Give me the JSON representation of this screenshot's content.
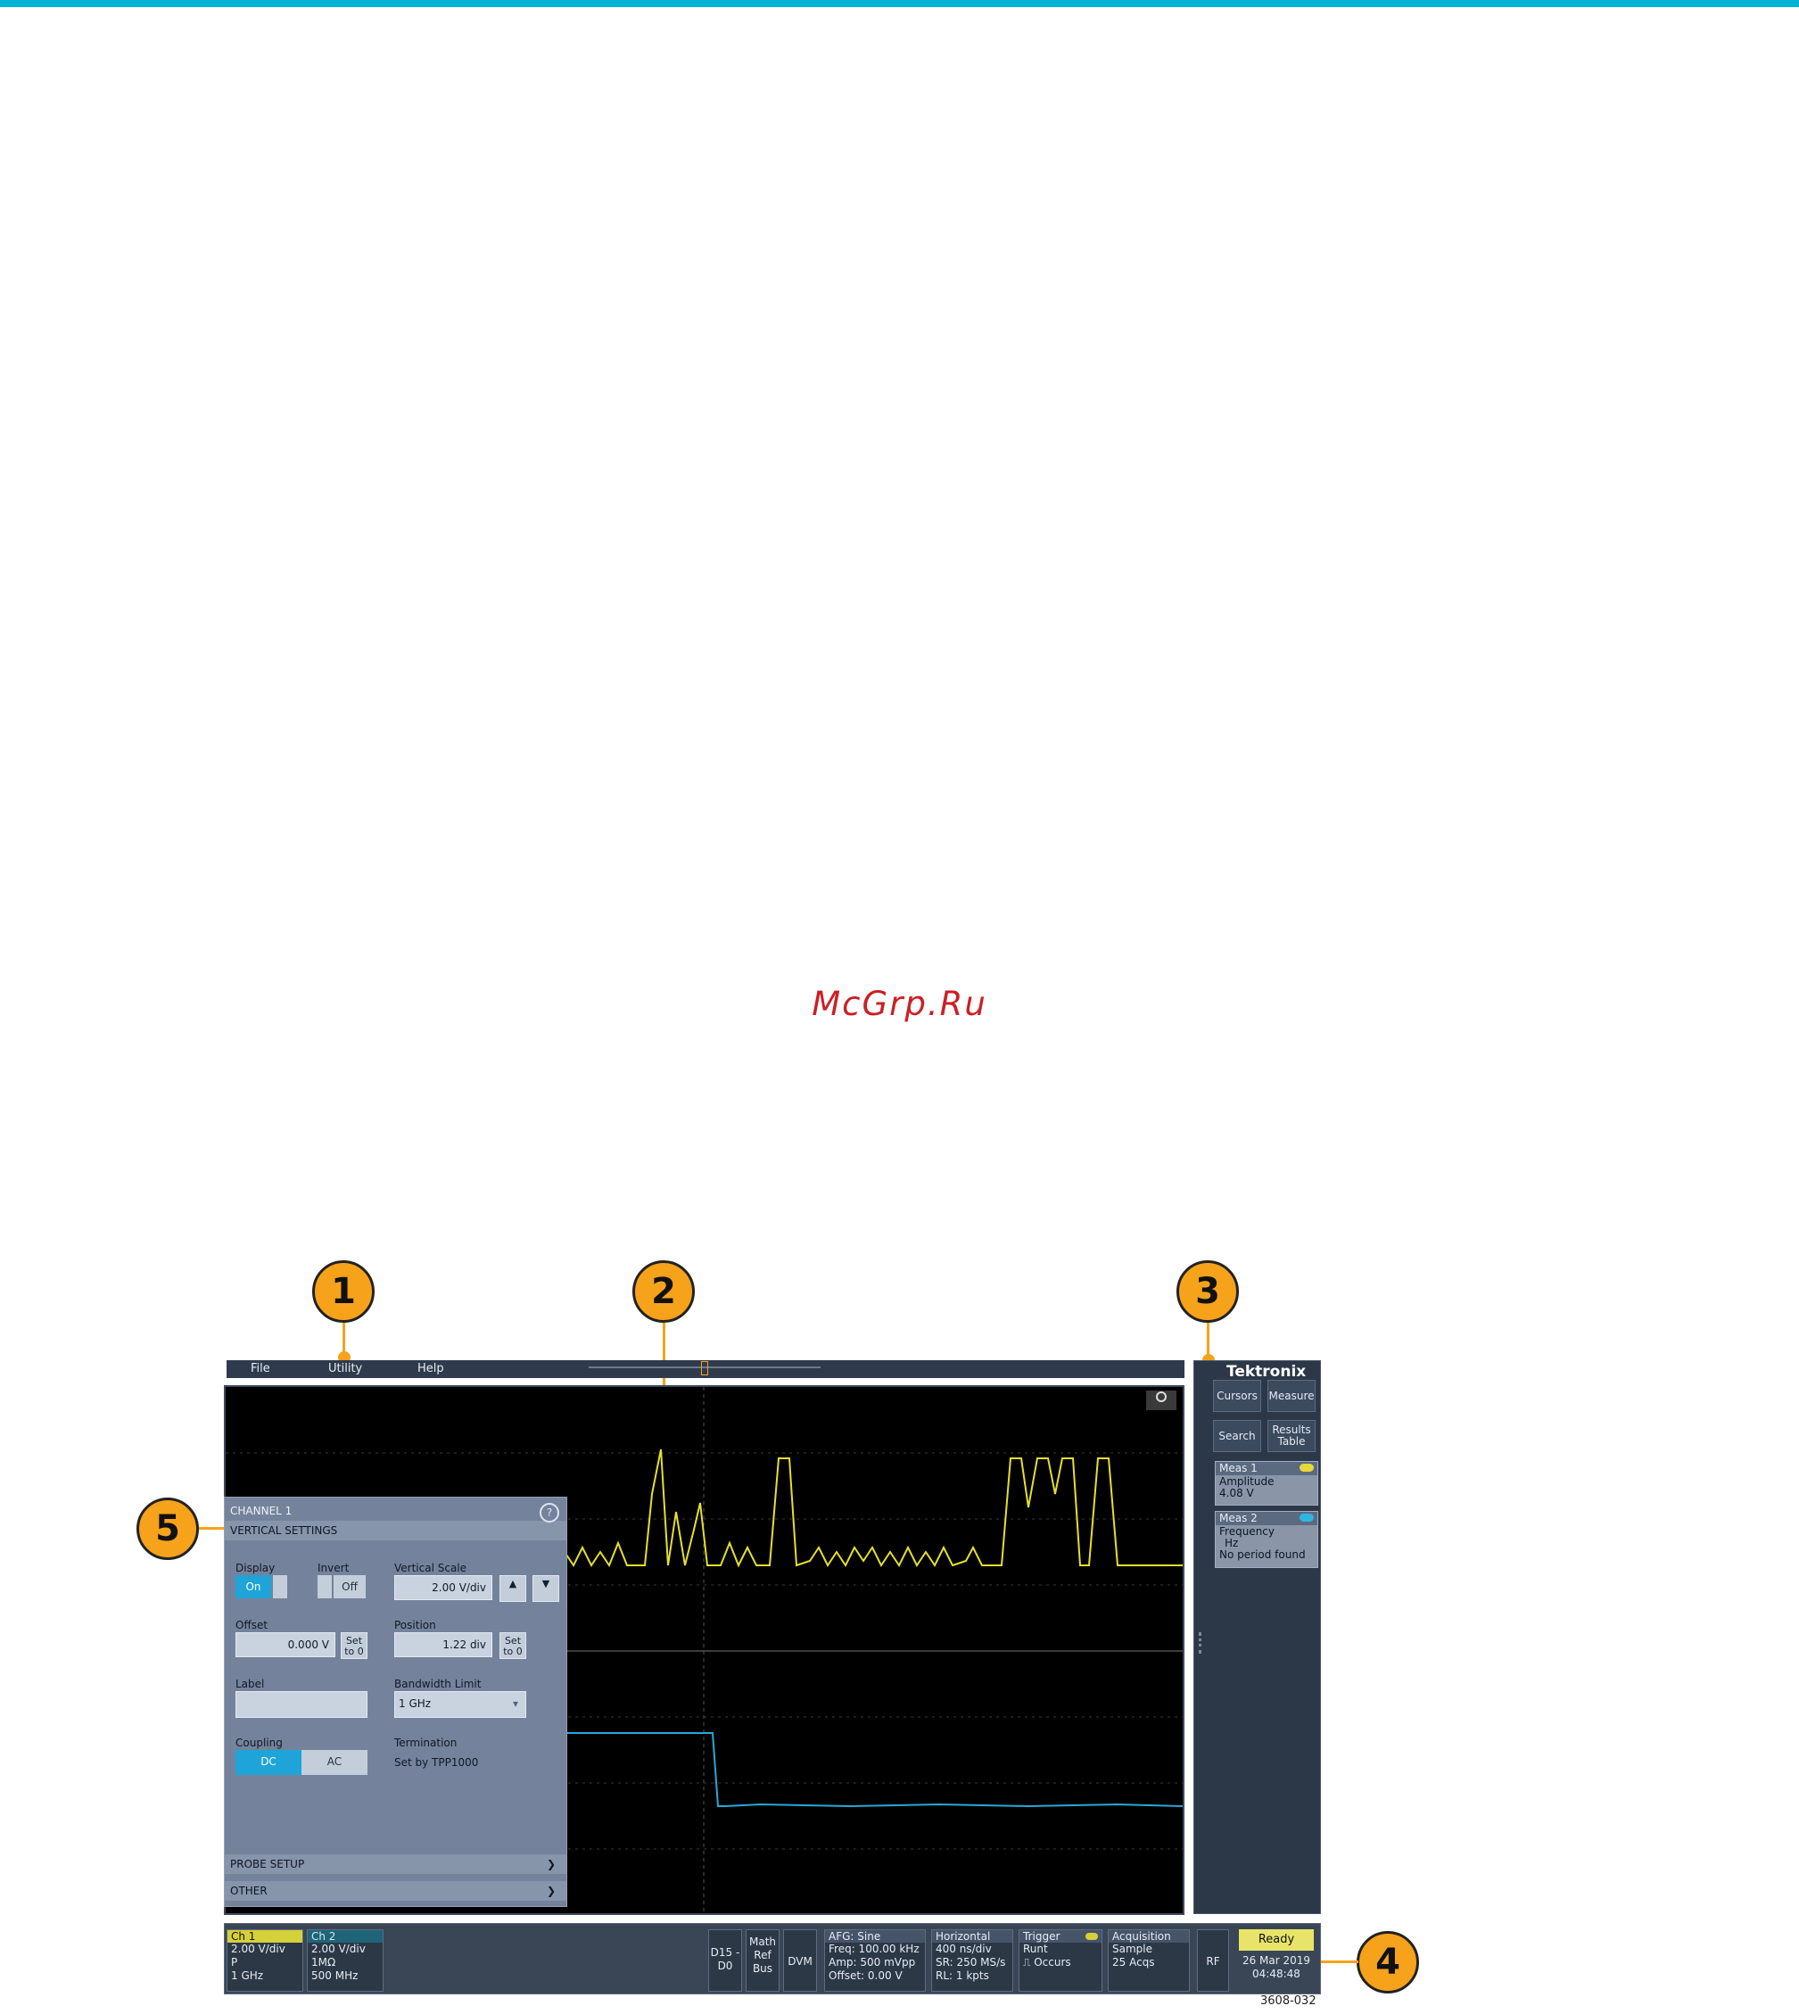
{
  "watermark": "McGrp.Ru",
  "callouts": [
    "1",
    "2",
    "3",
    "4",
    "5"
  ],
  "menu": {
    "file": "File",
    "utility": "Utility",
    "help": "Help"
  },
  "brand": "Tektronix",
  "side": {
    "cursors": "Cursors",
    "measure": "Measure",
    "search": "Search",
    "results_table": "Results Table",
    "meas1": {
      "title": "Meas 1",
      "badge_color": "#e8d83a",
      "line1": "Amplitude",
      "line2": "4.08 V"
    },
    "meas2": {
      "title": "Meas 2",
      "badge_color": "#2fb6e0",
      "line1": "Frequency",
      "line2": "Hz",
      "line3": "No period found"
    }
  },
  "dialog": {
    "title": "CHANNEL 1",
    "section": "VERTICAL SETTINGS",
    "display_label": "Display",
    "display_on": "On",
    "invert_label": "Invert",
    "invert_off": "Off",
    "vscale_label": "Vertical Scale",
    "vscale_value": "2.00 V/div",
    "offset_label": "Offset",
    "offset_value": "0.000 V",
    "set_to_0": "Set to 0",
    "position_label": "Position",
    "position_value": "1.22 div",
    "label_label": "Label",
    "label_value": "",
    "bw_label": "Bandwidth Limit",
    "bw_value": "1 GHz",
    "coupling_label": "Coupling",
    "coupling_dc": "DC",
    "coupling_ac": "AC",
    "termination_label": "Termination",
    "termination_value": "Set by TPP1000",
    "probe_setup": "PROBE SETUP",
    "other": "OTHER",
    "help_glyph": "?"
  },
  "bottom": {
    "ch1": {
      "title": "Ch 1",
      "l1": "2.00 V/div",
      "l2": "P",
      "l3": "1 GHz",
      "color": "#d6d03a"
    },
    "ch2": {
      "title": "Ch 2",
      "l1": "2.00 V/div",
      "l2": "1MΩ",
      "l3": "500 MHz",
      "color": "#2aa0c0"
    },
    "d15": "D15 -D0",
    "mathrefbus": "Math Ref Bus",
    "dvm": "DVM",
    "afg": {
      "title": "AFG: Sine",
      "l1": "Freq: 100.00 kHz",
      "l2": "Amp: 500 mVpp",
      "l3": "Offset: 0.00 V"
    },
    "horizontal": {
      "title": "Horizontal",
      "l1": "400 ns/div",
      "l2": "SR: 250 MS/s",
      "l3": "RL: 1 kpts"
    },
    "trigger": {
      "title": "Trigger",
      "l1": "Runt",
      "l2": "⎍ Occurs"
    },
    "acquisition": {
      "title": "Acquisition",
      "l1": "Sample",
      "l2": "25 Acqs"
    },
    "rf": "RF",
    "ready": "Ready",
    "date": "26 Mar 2019",
    "time": "04:48:48"
  },
  "figure_id": "3608-032",
  "colors": {
    "ch1_trace": "#e6e02a",
    "ch2_trace": "#27a9d8",
    "callout": "#f7a21b",
    "accent_bar": "#00b3d6"
  }
}
